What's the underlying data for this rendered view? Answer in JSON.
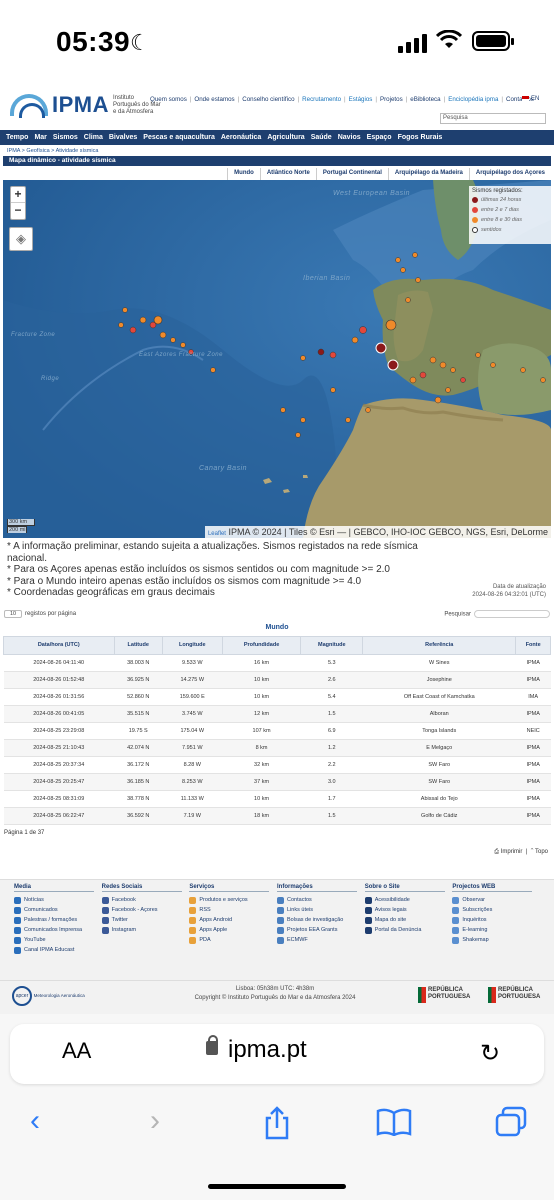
{
  "status": {
    "time": "05:39"
  },
  "header": {
    "logo_name": "IPMA",
    "logo_sub": "Instituto Português do Mar e da Atmosfera",
    "topnav": [
      "Quem somos",
      "Onde estamos",
      "Conselho científico",
      "Recrutamento",
      "Estágios",
      "Projetos",
      "eBiblioteca",
      "Enciclopédia ipma",
      "Contactos"
    ],
    "lang": "EN",
    "search_placeholder": "Pesquisa"
  },
  "mainnav": [
    "Tempo",
    "Mar",
    "Sismos",
    "Clima",
    "Bivalves",
    "Pescas e aquacultura",
    "Aeronáutica",
    "Agricultura",
    "Saúde",
    "Navios",
    "Espaço",
    "Fogos Rurais"
  ],
  "breadcrumb": "IPMA > Geofísica > Atividade sísmica",
  "section_title": "Mapa dinâmico - atividade sísmica",
  "region_tabs": [
    "Mundo",
    "Atlântico Norte",
    "Portugal Continental",
    "Arquipélago da Madeira",
    "Arquipélago dos Açores"
  ],
  "map": {
    "zoom_in": "+",
    "zoom_out": "−",
    "legend_title": "Sismos registados:",
    "legend": [
      {
        "label": "últimas 24 horas",
        "color": "#8b1a1a"
      },
      {
        "label": "entre 2 e 7 dias",
        "color": "#e2473b"
      },
      {
        "label": "entre 8 e 30 dias",
        "color": "#f08a2a"
      },
      {
        "label": "sentidos",
        "color": "#ffffff"
      }
    ],
    "labels": [
      "West European Basin",
      "Iberian Basin",
      "Canary Basin",
      "East Azores Fracture Zone",
      "Ridge",
      "Fracture Zone"
    ],
    "scale_km": "300 km",
    "scale_mi": "200 mi",
    "leaflet": "Leaflet",
    "attribution": "IPMA © 2024 | Tiles © Esri — | GEBCO, IHO-IOC GEBCO, NGS, Esri, DeLorme"
  },
  "notes": [
    "* A informação preliminar, estando sujeita a atualizações. Sismos registados na rede sísmica nacional.",
    "* Para os Açores apenas estão incluídos os sismos sentidos ou com magnitude >= 2.0",
    "* Para o Mundo inteiro apenas estão incluídos os sismos com magnitude >= 4.0",
    "* Coordenadas geográficas em graus decimais"
  ],
  "update_label": "Data de atualização",
  "update_value": "2024-08-26 04:32:01 (UTC)",
  "table_ctrl": {
    "page_size": "10",
    "page_size_label": "registos por página",
    "search_label": "Pesquisar"
  },
  "table_title": "Mundo",
  "table_headers": [
    "Data/hora (UTC)",
    "Latitude",
    "Longitude",
    "Profundidade",
    "Magnitude",
    "Referência",
    "Fonte"
  ],
  "table_rows": [
    [
      "2024-08-26 04:11:40",
      "38.003 N",
      "9.533 W",
      "16 km",
      "5.3",
      "W Sines",
      "IPMA"
    ],
    [
      "2024-08-26 01:52:48",
      "36.925 N",
      "14.275 W",
      "10 km",
      "2.6",
      "Josephine",
      "IPMA"
    ],
    [
      "2024-08-26 01:31:56",
      "52.860 N",
      "159.600 E",
      "10 km",
      "5.4",
      "Off East Coast of Kamchatka",
      "IMA"
    ],
    [
      "2024-08-26 00:41:05",
      "35.515 N",
      "3.745 W",
      "12 km",
      "1.5",
      "Alboran",
      "IPMA"
    ],
    [
      "2024-08-25 23:29:08",
      "19.75 S",
      "175.04 W",
      "107 km",
      "6.9",
      "Tonga Islands",
      "NEIC"
    ],
    [
      "2024-08-25 21:10:43",
      "42.074 N",
      "7.951 W",
      "8 km",
      "1.2",
      "E Melgaço",
      "IPMA"
    ],
    [
      "2024-08-25 20:37:34",
      "36.172 N",
      "8.28 W",
      "32 km",
      "2.2",
      "SW Faro",
      "IPMA"
    ],
    [
      "2024-08-25 20:25:47",
      "36.185 N",
      "8.253 W",
      "37 km",
      "3.0",
      "SW Faro",
      "IPMA"
    ],
    [
      "2024-08-25 08:31:09",
      "38.778 N",
      "11.133 W",
      "10 km",
      "1.7",
      "Abissal do Tejo",
      "IPMA"
    ],
    [
      "2024-08-25 06:22:47",
      "36.592 N",
      "7.19 W",
      "18 km",
      "1.5",
      "Golfo de Cádiz",
      "IPMA"
    ]
  ],
  "pagination": "Página 1 de 37",
  "print_label": "Imprimir",
  "top_label": "Topo",
  "footer": {
    "cols": [
      {
        "title": "Media",
        "items": [
          "Notícias",
          "Comunicados",
          "Palestras / formações",
          "Comunicados Imprensa",
          "YouTube",
          "Canal IPMA Educast"
        ]
      },
      {
        "title": "Redes Sociais",
        "items": [
          "Facebook",
          "Facebook - Açores",
          "Twitter",
          "Instagram"
        ]
      },
      {
        "title": "Serviços",
        "items": [
          "Produtos e serviços",
          "RSS",
          "Apps Android",
          "Apps Apple",
          "PDA"
        ]
      },
      {
        "title": "Informações",
        "items": [
          "Contactos",
          "Links úteis",
          "Bolsas de investigação",
          "Projetos EEA Grants",
          "ECMWF"
        ]
      },
      {
        "title": "Sobre o Site",
        "items": [
          "Acessibilidade",
          "Avisos legais",
          "Mapa do site",
          "Portal da Denúncia"
        ]
      },
      {
        "title": "Projectos WEB",
        "items": [
          "Observar",
          "Subscrições",
          "Inquéritos",
          "E-learning",
          "Shakemap"
        ]
      }
    ],
    "lisboa": "Lisboa:  05h38m       UTC:  4h38m",
    "copyright": "Copyright © Instituto Português do Mar e da Atmosfera 2024",
    "apcer": "apcer",
    "apcer_sub": "Meteorologia Aeronáutica",
    "rp": "REPÚBLICA PORTUGUESA"
  },
  "browser": {
    "aa": "AA",
    "url": "ipma.pt"
  }
}
